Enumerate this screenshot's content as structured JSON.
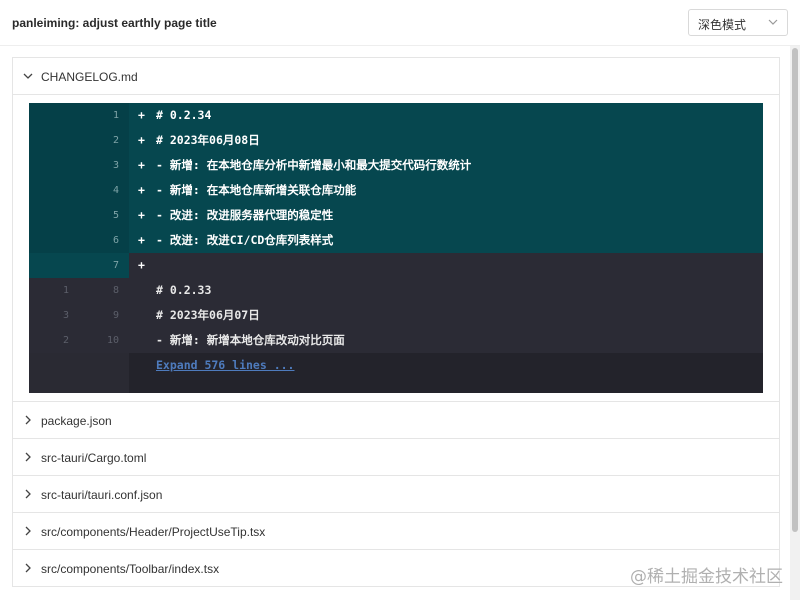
{
  "header": {
    "commit_title": "panleiming: adjust earthly page title",
    "theme_select": {
      "value": "深色模式",
      "icon": "chevron-down-icon"
    }
  },
  "files": [
    {
      "name": "CHANGELOG.md",
      "expanded": true
    },
    {
      "name": "package.json",
      "expanded": false
    },
    {
      "name": "src-tauri/Cargo.toml",
      "expanded": false
    },
    {
      "name": "src-tauri/tauri.conf.json",
      "expanded": false
    },
    {
      "name": "src/components/Header/ProjectUseTip.tsx",
      "expanded": false
    },
    {
      "name": "src/components/Toolbar/index.tsx",
      "expanded": false
    }
  ],
  "diff": {
    "lines": [
      {
        "type": "add",
        "old": "",
        "new": "1",
        "marker": "+",
        "text": "# 0.2.34"
      },
      {
        "type": "add",
        "old": "",
        "new": "2",
        "marker": "+",
        "text": "# 2023年06月08日"
      },
      {
        "type": "add",
        "old": "",
        "new": "3",
        "marker": "+",
        "text": "- 新增: 在本地仓库分析中新增最小和最大提交代码行数统计"
      },
      {
        "type": "add",
        "old": "",
        "new": "4",
        "marker": "+",
        "text": "- 新增: 在本地仓库新增关联仓库功能"
      },
      {
        "type": "add",
        "old": "",
        "new": "5",
        "marker": "+",
        "text": "- 改进: 改进服务器代理的稳定性"
      },
      {
        "type": "add",
        "old": "",
        "new": "6",
        "marker": "+",
        "text": "- 改进: 改进CI/CD仓库列表样式"
      },
      {
        "type": "ctx-add",
        "old": "",
        "new": "7",
        "marker": "+",
        "text": ""
      },
      {
        "type": "ctx",
        "old": "1",
        "new": "8",
        "marker": "",
        "text": "# 0.2.33"
      },
      {
        "type": "ctx",
        "old": "3",
        "new": "9",
        "marker": "",
        "text": "# 2023年06月07日"
      },
      {
        "type": "ctx",
        "old": "2",
        "new": "10",
        "marker": "",
        "text": "- 新增: 新增本地仓库改动对比页面"
      }
    ],
    "expand_label": "Expand 576 lines ..."
  },
  "watermark": "@稀土掘金技术社区",
  "colors": {
    "added_bg": "#06474f",
    "context_bg": "#2b2b35",
    "link": "#4e7bbd"
  }
}
